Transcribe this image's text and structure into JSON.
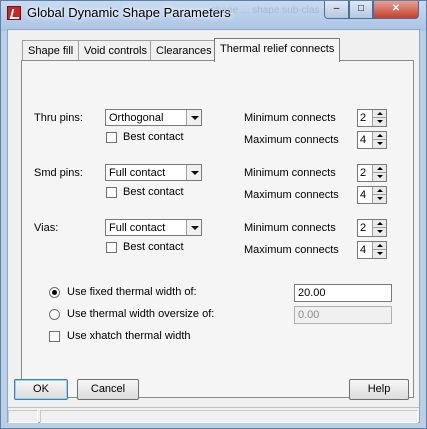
{
  "window": {
    "title": "Global Dynamic Shape Parameters",
    "ghost_title": "shape ... shape sub-clas",
    "caption_buttons": {
      "minimize": "–",
      "maximize": "□",
      "close": "✕"
    }
  },
  "tabs": [
    {
      "label": "Shape fill"
    },
    {
      "label": "Void controls"
    },
    {
      "label": "Clearances"
    },
    {
      "label": "Thermal relief connects"
    }
  ],
  "thru_pins": {
    "label": "Thru pins:",
    "type_value": "Orthogonal",
    "best_contact_label": "Best contact",
    "min_label": "Minimum connects",
    "min_value": "2",
    "max_label": "Maximum connects",
    "max_value": "4"
  },
  "smd_pins": {
    "label": "Smd pins:",
    "type_value": "Full contact",
    "best_contact_label": "Best contact",
    "min_label": "Minimum connects",
    "min_value": "2",
    "max_label": "Maximum connects",
    "max_value": "4"
  },
  "vias": {
    "label": "Vias:",
    "type_value": "Full contact",
    "best_contact_label": "Best contact",
    "min_label": "Minimum connects",
    "min_value": "2",
    "max_label": "Maximum connects",
    "max_value": "4"
  },
  "thermal_width": {
    "fixed_label": "Use fixed thermal width of:",
    "fixed_value": "20.00",
    "oversize_label": "Use thermal width oversize of:",
    "oversize_value": "0.00",
    "xhatch_label": "Use xhatch thermal width"
  },
  "buttons": {
    "ok": "OK",
    "cancel": "Cancel",
    "help": "Help"
  },
  "colors": {
    "frame": "#b9cfe8",
    "close": "#c0412f",
    "panel": "#f5f5f5"
  }
}
